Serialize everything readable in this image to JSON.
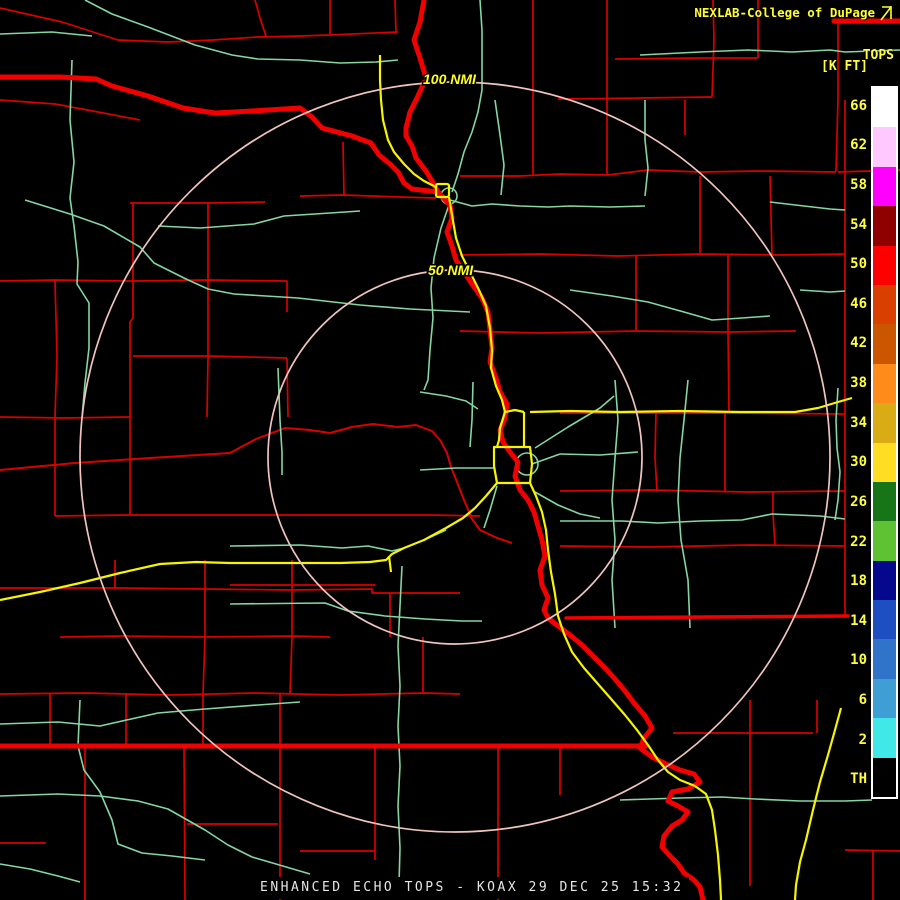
{
  "header": {
    "brand": "NEXLAB-College of DuPage",
    "logo_icon": "nexlab-flag-glyph"
  },
  "product": {
    "name": "TOPS",
    "units": "[K FT]"
  },
  "range_rings": {
    "outer_label": "100 NMI",
    "inner_label": "50 NMI"
  },
  "color_scale": {
    "segments": [
      {
        "label": "66",
        "color": "#ffffff"
      },
      {
        "label": "62",
        "color": "#ffc9ff"
      },
      {
        "label": "58",
        "color": "#ff00ff"
      },
      {
        "label": "54",
        "color": "#8f0000"
      },
      {
        "label": "50",
        "color": "#ff0000"
      },
      {
        "label": "46",
        "color": "#d94000"
      },
      {
        "label": "42",
        "color": "#cc5500"
      },
      {
        "label": "38",
        "color": "#ff8c1a"
      },
      {
        "label": "34",
        "color": "#d9ac15"
      },
      {
        "label": "30",
        "color": "#ffdd22"
      },
      {
        "label": "26",
        "color": "#177517"
      },
      {
        "label": "22",
        "color": "#5fc232"
      },
      {
        "label": "18",
        "color": "#05088c"
      },
      {
        "label": "14",
        "color": "#1d4fc3"
      },
      {
        "label": "10",
        "color": "#2f74c9"
      },
      {
        "label": "6",
        "color": "#3f9fd4"
      },
      {
        "label": "2",
        "color": "#40e8e8"
      },
      {
        "label": "TH",
        "color": "#000000"
      }
    ]
  },
  "status_bar": {
    "text": "ENHANCED ECHO TOPS - KOAX 29 DEC 25 15:32"
  },
  "colors": {
    "background": "#000000",
    "county_lines": "#d90000",
    "state_borders": "#f20000",
    "local_roads": "#85d6a2",
    "interstates": "#f5f500",
    "range_rings": "#efc4bc",
    "label_yellow": "#ffff40",
    "status_text": "#e6e6e6",
    "scale_border": "#ffffff"
  }
}
